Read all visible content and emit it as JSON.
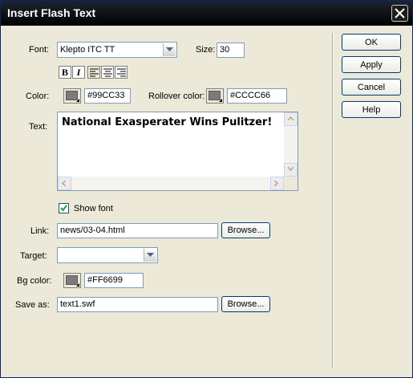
{
  "window": {
    "title": "Insert Flash Text"
  },
  "font": {
    "label": "Font:",
    "value": "Klepto ITC TT"
  },
  "size": {
    "label": "Size:",
    "value": "30"
  },
  "format_buttons": {
    "bold": "B",
    "italic": "I"
  },
  "color": {
    "label": "Color:",
    "value": "#99CC33"
  },
  "rollover_color": {
    "label": "Rollover color:",
    "value": "#CCCC66"
  },
  "text": {
    "label": "Text:",
    "value": "National Exasperater Wins Pulitzer!"
  },
  "show_font": {
    "label": "Show font",
    "checked": true
  },
  "link": {
    "label": "Link:",
    "value": "news/03-04.html",
    "browse": "Browse..."
  },
  "target": {
    "label": "Target:",
    "value": ""
  },
  "bg_color": {
    "label": "Bg color:",
    "value": "#FF6699"
  },
  "save_as": {
    "label": "Save as:",
    "value": "text1.swf",
    "browse": "Browse..."
  },
  "buttons": {
    "ok": "OK",
    "apply": "Apply",
    "cancel": "Cancel",
    "help": "Help"
  }
}
